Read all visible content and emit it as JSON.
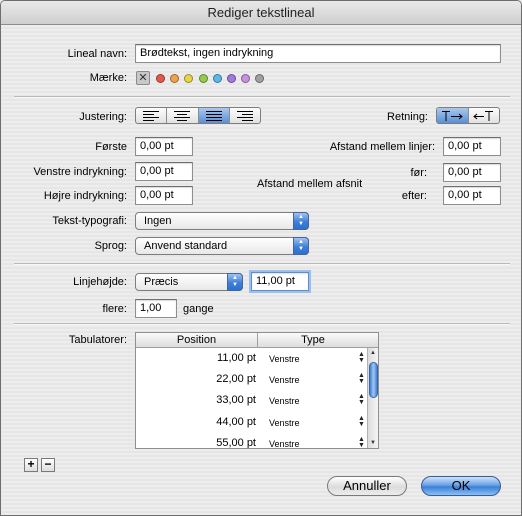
{
  "window": {
    "title": "Rediger tekstlineal"
  },
  "name": {
    "label": "Lineal navn:",
    "value": "Brødtekst, ingen indrykning"
  },
  "mark": {
    "label": "Mærke:",
    "none_glyph": "✕",
    "colors": [
      "#e05a4a",
      "#f0a24a",
      "#e8d44a",
      "#92cc4a",
      "#5cb8e6",
      "#a07ae0",
      "#c890e0",
      "#a0a0a0"
    ]
  },
  "alignment": {
    "label": "Justering:",
    "options": [
      "align-left",
      "align-center",
      "align-justify",
      "align-right"
    ],
    "selected": 2
  },
  "direction": {
    "label": "Retning:",
    "options": [
      "left-to-right",
      "right-to-left"
    ],
    "selected": 0
  },
  "indents": {
    "first_label": "Første",
    "first_value": "0,00 pt",
    "left_label": "Venstre indrykning:",
    "left_value": "0,00 pt",
    "right_label": "Højre indrykning:",
    "right_value": "0,00 pt"
  },
  "spacing": {
    "lines_label": "Afstand mellem linjer:",
    "lines_value": "0,00 pt",
    "paragraphs_label": "Afstand mellem afsnit",
    "before_label": "før:",
    "before_value": "0,00 pt",
    "after_label": "efter:",
    "after_value": "0,00 pt"
  },
  "typography": {
    "label": "Tekst-typografi:",
    "value": "Ingen"
  },
  "language": {
    "label": "Sprog:",
    "value": "Anvend standard"
  },
  "line_height": {
    "label": "Linjehøjde:",
    "mode": "Præcis",
    "value": "11,00 pt",
    "multiple_label": "flere:",
    "multiple_value": "1,00",
    "multiple_unit": "gange"
  },
  "tabs": {
    "label": "Tabulatorer:",
    "columns": [
      "Position",
      "Type"
    ],
    "rows": [
      {
        "position": "11,00 pt",
        "type": "Venstre"
      },
      {
        "position": "22,00 pt",
        "type": "Venstre"
      },
      {
        "position": "33,00 pt",
        "type": "Venstre"
      },
      {
        "position": "44,00 pt",
        "type": "Venstre"
      },
      {
        "position": "55,00 pt",
        "type": "Venstre"
      }
    ]
  },
  "buttons": {
    "add": "+",
    "remove": "−",
    "cancel": "Annuller",
    "ok": "OK"
  }
}
